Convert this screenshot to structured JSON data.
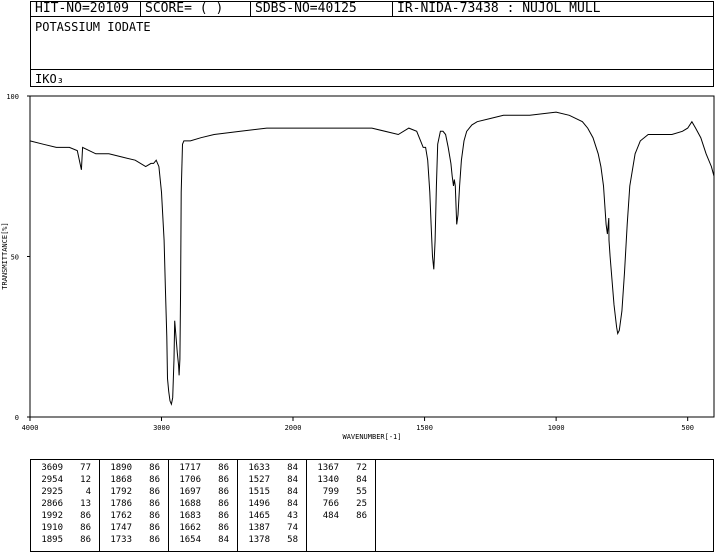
{
  "header": {
    "hit_no": "HIT-NO=20109",
    "score": "SCORE=  (   )",
    "sdbs_no": "SDBS-NO=40125",
    "ir_nida": "IR-NIDA-73438 : NUJOL MULL"
  },
  "compound_name": "POTASSIUM IODATE",
  "formula": "IKO₃",
  "chart_data": {
    "type": "line",
    "xlabel": "WAVENUMBER[-1]",
    "ylabel": "TRANSMITTANCE[%]",
    "xlim": [
      4000,
      400
    ],
    "ylim": [
      0,
      100
    ],
    "x_ticks": [
      "4000",
      "3000",
      "2000",
      "1500",
      "1000",
      "500"
    ],
    "y_ticks": [
      "100",
      "50",
      "0"
    ],
    "grid": false,
    "series": [
      {
        "x": [
          4000,
          3900,
          3800,
          3700,
          3640,
          3609,
          3600,
          3500,
          3400,
          3300,
          3200,
          3120,
          3080,
          3060,
          3040,
          3020,
          3000,
          2980,
          2970,
          2960,
          2954,
          2945,
          2935,
          2925,
          2915,
          2905,
          2900,
          2890,
          2880,
          2870,
          2866,
          2860,
          2855,
          2850,
          2840,
          2830,
          2800,
          2780,
          2700,
          2600,
          2400,
          2200,
          2000,
          1900,
          1800,
          1700,
          1600,
          1560,
          1530,
          1515,
          1505,
          1496,
          1488,
          1480,
          1475,
          1470,
          1465,
          1460,
          1455,
          1450,
          1440,
          1430,
          1420,
          1410,
          1400,
          1395,
          1390,
          1387,
          1383,
          1378,
          1373,
          1367,
          1360,
          1350,
          1340,
          1320,
          1300,
          1250,
          1200,
          1100,
          1000,
          950,
          900,
          880,
          860,
          840,
          830,
          820,
          815,
          810,
          805,
          800,
          799,
          795,
          790,
          780,
          770,
          766,
          760,
          750,
          740,
          730,
          720,
          700,
          680,
          650,
          600,
          560,
          520,
          500,
          484,
          470,
          450,
          430,
          410,
          400
        ],
        "y": [
          86,
          85,
          84,
          84,
          83,
          77,
          84,
          82,
          82,
          81,
          80,
          78,
          79,
          79,
          80,
          78,
          70,
          55,
          40,
          25,
          12,
          8,
          5,
          4,
          6,
          18,
          30,
          25,
          20,
          16,
          13,
          18,
          40,
          70,
          85,
          86,
          86,
          86,
          87,
          88,
          89,
          90,
          90,
          90,
          90,
          90,
          88,
          90,
          89,
          86,
          84,
          84,
          80,
          70,
          60,
          50,
          46,
          55,
          72,
          85,
          89,
          89,
          88,
          84,
          79,
          75,
          72,
          74,
          72,
          60,
          63,
          72,
          80,
          86,
          89,
          91,
          92,
          93,
          94,
          94,
          95,
          94,
          92,
          90,
          87,
          82,
          78,
          72,
          66,
          60,
          57,
          62,
          55,
          50,
          45,
          35,
          28,
          26,
          27,
          33,
          45,
          60,
          72,
          82,
          86,
          88,
          88,
          88,
          89,
          90,
          92,
          90,
          87,
          82,
          78,
          75
        ]
      }
    ],
    "peaks_header": "",
    "peak_table": [
      [
        [
          "3609",
          "77"
        ],
        [
          "2954",
          "12"
        ],
        [
          "2925",
          "4"
        ],
        [
          "2866",
          "13"
        ],
        [
          "1992",
          "86"
        ],
        [
          "1910",
          "86"
        ],
        [
          "1895",
          "86"
        ]
      ],
      [
        [
          "1890",
          "86"
        ],
        [
          "1868",
          "86"
        ],
        [
          "1792",
          "86"
        ],
        [
          "1786",
          "86"
        ],
        [
          "1762",
          "86"
        ],
        [
          "1747",
          "86"
        ],
        [
          "1733",
          "86"
        ]
      ],
      [
        [
          "1717",
          "86"
        ],
        [
          "1706",
          "86"
        ],
        [
          "1697",
          "86"
        ],
        [
          "1688",
          "86"
        ],
        [
          "1683",
          "86"
        ],
        [
          "1662",
          "86"
        ],
        [
          "1654",
          "84"
        ]
      ],
      [
        [
          "1633",
          "84"
        ],
        [
          "1527",
          "84"
        ],
        [
          "1515",
          "84"
        ],
        [
          "1496",
          "84"
        ],
        [
          "1465",
          "43"
        ],
        [
          "1387",
          "74"
        ],
        [
          "1378",
          "58"
        ]
      ],
      [
        [
          "1367",
          "72"
        ],
        [
          "1340",
          "84"
        ],
        [
          "799",
          "55"
        ],
        [
          "766",
          "25"
        ],
        [
          "484",
          "86"
        ]
      ]
    ]
  }
}
